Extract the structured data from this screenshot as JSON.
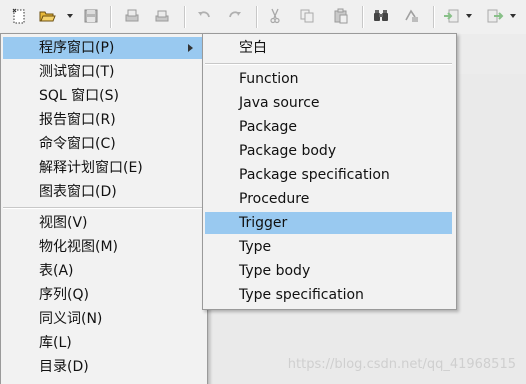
{
  "toolbar": {
    "buttons": [
      {
        "name": "new-icon"
      },
      {
        "name": "open-folder-icon"
      },
      {
        "name": "save-icon"
      },
      {
        "name": "print-icon"
      },
      {
        "name": "print-preview-icon"
      },
      {
        "name": "undo-icon"
      },
      {
        "name": "redo-icon"
      },
      {
        "name": "cut-icon"
      },
      {
        "name": "copy-icon"
      },
      {
        "name": "paste-icon"
      },
      {
        "name": "find-icon"
      },
      {
        "name": "replace-icon"
      },
      {
        "name": "import-icon"
      },
      {
        "name": "export-icon"
      }
    ]
  },
  "menu_left": {
    "items": [
      {
        "label": "程序窗口(P)",
        "submenu": true,
        "highlighted": true
      },
      {
        "label": "测试窗口(T)"
      },
      {
        "label": "SQL 窗口(S)"
      },
      {
        "label": "报告窗口(R)"
      },
      {
        "label": "命令窗口(C)"
      },
      {
        "label": "解释计划窗口(E)"
      },
      {
        "label": "图表窗口(D)"
      },
      {
        "label": "视图(V)"
      },
      {
        "label": "物化视图(M)"
      },
      {
        "label": "表(A)"
      },
      {
        "label": "序列(Q)"
      },
      {
        "label": "同义词(N)"
      },
      {
        "label": "库(L)"
      },
      {
        "label": "目录(D)"
      }
    ]
  },
  "menu_right": {
    "items": [
      {
        "label": "空白"
      },
      {
        "label": "Function"
      },
      {
        "label": "Java source"
      },
      {
        "label": "Package"
      },
      {
        "label": "Package body"
      },
      {
        "label": "Package specification"
      },
      {
        "label": "Procedure"
      },
      {
        "label": "Trigger",
        "highlighted": true
      },
      {
        "label": "Type"
      },
      {
        "label": "Type body"
      },
      {
        "label": "Type specification"
      }
    ]
  },
  "watermark": "https://blog.csdn.net/qq_41968515",
  "colors": {
    "highlight": "#99c9f0",
    "menu_bg": "#f2f2f2",
    "toolbar_bg": "#f0f0f0"
  }
}
